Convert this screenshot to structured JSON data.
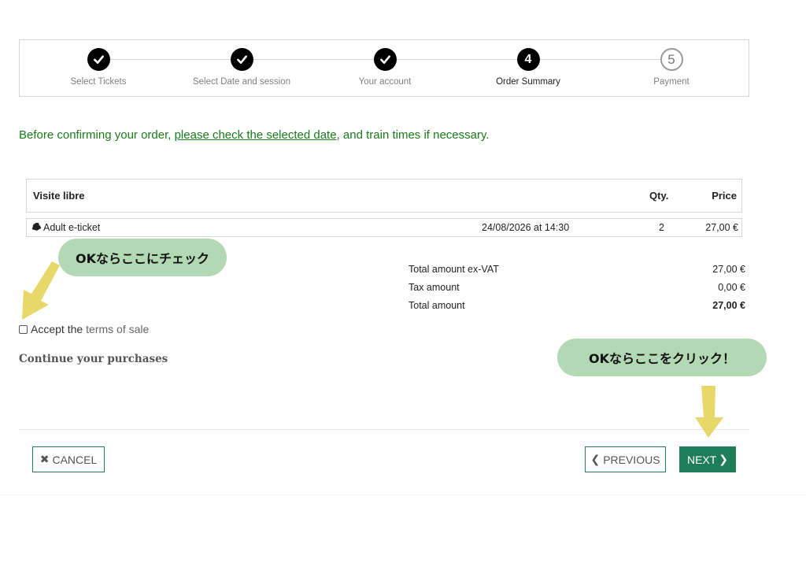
{
  "stepper": {
    "steps": [
      {
        "label": "Select Tickets",
        "state": "done"
      },
      {
        "label": "Select Date and session",
        "state": "done"
      },
      {
        "label": "Your account",
        "state": "done"
      },
      {
        "label": "Order Summary",
        "state": "current",
        "number": "4"
      },
      {
        "label": "Payment",
        "state": "pending",
        "number": "5"
      }
    ]
  },
  "notice": {
    "before": "Before confirming your order, ",
    "link": "please check the selected date",
    "after": ", and train times if necessary."
  },
  "table": {
    "header": {
      "product": "Visite libre",
      "qty": "Qty.",
      "price": "Price"
    },
    "rows": [
      {
        "icon": "ticket-icon",
        "name": "Adult e-ticket",
        "date": "24/08/2026 at 14:30",
        "qty": "2",
        "price": "27,00 €"
      }
    ]
  },
  "totals": {
    "ex_vat_label": "Total amount ex-VAT",
    "ex_vat_value": "27,00 €",
    "tax_label": "Tax amount",
    "tax_value": "0,00 €",
    "total_label": "Total amount",
    "total_value": "27,00 €"
  },
  "terms": {
    "prefix": "Accept the ",
    "link": "terms of sale",
    "checked": false
  },
  "continue_label": "Continue your purchases",
  "buttons": {
    "cancel": "CANCEL",
    "previous": "PREVIOUS",
    "next": "NEXT"
  },
  "callouts": {
    "check_hint": "OKならここにチェック",
    "click_hint": "OKならここをクリック！"
  },
  "colors": {
    "accent": "#1e7e5a",
    "notice": "#1a7a1a",
    "bubble": "#b2d8b4",
    "arrow": "#e8d86a"
  }
}
